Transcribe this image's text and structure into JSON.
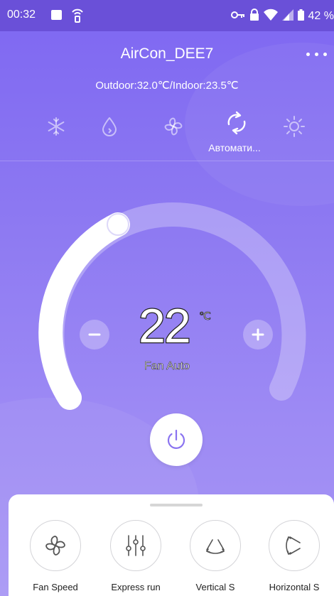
{
  "status_bar": {
    "time": "00:32",
    "battery": "42 %"
  },
  "header": {
    "title": "AirCon_DEE7",
    "temperatures": "Outdoor:32.0℃/Indoor:23.5℃"
  },
  "modes": {
    "items": [
      {
        "icon": "snowflake-icon",
        "name": "cool"
      },
      {
        "icon": "water-drop-icon",
        "name": "dry"
      },
      {
        "icon": "fan-icon",
        "name": "fan"
      },
      {
        "icon": "auto-cycle-icon",
        "name": "auto"
      },
      {
        "icon": "sun-icon",
        "name": "heat"
      }
    ],
    "selected_label": "Автомати..."
  },
  "control": {
    "temperature": "22",
    "unit": "℃",
    "fan_status": "Fan Auto",
    "minus_label": "−",
    "plus_label": "+"
  },
  "features": [
    {
      "label": "Fan Speed",
      "icon": "fan-icon"
    },
    {
      "label": "Express run",
      "icon": "sliders-icon"
    },
    {
      "label": "Vertical S",
      "icon": "vertical-swing-icon"
    },
    {
      "label": "Horizontal S",
      "icon": "horizontal-swing-icon"
    }
  ],
  "colors": {
    "background_top": "#7e67f2",
    "background_bottom": "#a796f5",
    "status_bar": "#6a50d8",
    "accent": "#8a73f0"
  }
}
